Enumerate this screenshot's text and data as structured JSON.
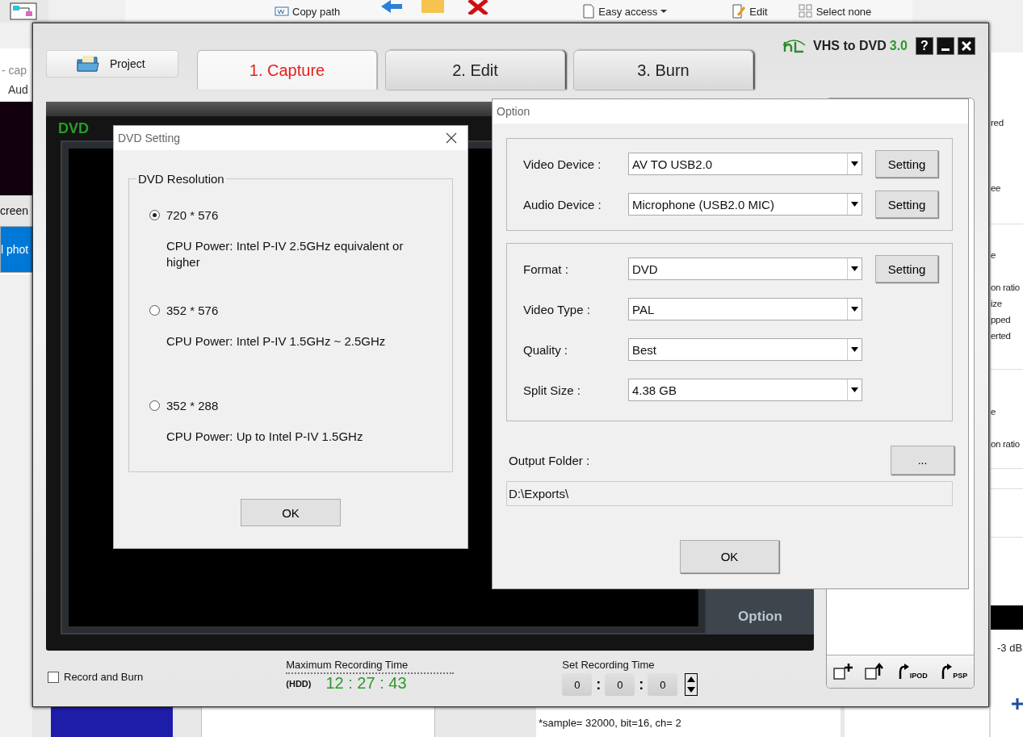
{
  "explorer_ribbon": {
    "items": [
      {
        "kind": "copy-path",
        "label": "Copy path"
      },
      {
        "kind": "easy-access",
        "label": "Easy access"
      },
      {
        "kind": "edit",
        "label": "Edit"
      },
      {
        "kind": "select-none",
        "label": "Select none"
      }
    ]
  },
  "left_window": {
    "title_fragment": "- cap",
    "tab_fragment": "Aud",
    "items": [
      {
        "label": "creen",
        "selected": false
      },
      {
        "label": "l phot",
        "selected": true
      }
    ]
  },
  "right_window": {
    "lines": [
      "red",
      "ee",
      "e",
      "on ratio",
      "ize",
      "pped",
      "erted",
      "e",
      "on ratio"
    ],
    "meter_label": "-3 dB"
  },
  "log_window": {
    "lines": [
      "*sample= 32000, bit=16, ch= 2"
    ]
  },
  "app": {
    "name": "VHS to DVD",
    "version": "3.0",
    "help_button": "?",
    "project_button": "Project",
    "tabs": [
      {
        "label": "1. Capture",
        "selected": true
      },
      {
        "label": "2. Edit",
        "selected": false
      },
      {
        "label": "3. Burn",
        "selected": false
      }
    ],
    "preview": {
      "format": "DVD",
      "option_button": "Option"
    },
    "record_and_burn": {
      "label": "Record and Burn",
      "checked": false
    },
    "max_recording_time": {
      "label": "Maximum Recording Time",
      "drive": "(HDD)",
      "value": "12 : 27 : 43"
    },
    "set_recording_time": {
      "label": "Set Recording Time",
      "fields": [
        "0",
        "0",
        "0"
      ],
      "separators": [
        ":",
        ":"
      ]
    },
    "list_tools": [
      {
        "kind": "add"
      },
      {
        "kind": "export"
      },
      {
        "kind": "convert",
        "label": "IPOD"
      },
      {
        "kind": "convert",
        "label": "PSP"
      }
    ]
  },
  "dvd_setting": {
    "title": "DVD Setting",
    "group": "DVD Resolution",
    "options": [
      {
        "label": "720 * 576",
        "description": "CPU Power: Intel P-IV 2.5GHz equivalent or higher",
        "selected": true
      },
      {
        "label": "352 * 576",
        "description": "CPU Power: Intel P-IV 1.5GHz ~ 2.5GHz",
        "selected": false
      },
      {
        "label": "352 * 288",
        "description": "CPU Power: Up to Intel P-IV 1.5GHz",
        "selected": false
      }
    ],
    "ok_button": "OK"
  },
  "option_dialog": {
    "title": "Option",
    "device_group": [
      {
        "label": "Video Device :",
        "value": "AV TO USB2.0",
        "button": "Setting"
      },
      {
        "label": "Audio Device :",
        "value": "Microphone (USB2.0 MIC)",
        "button": "Setting"
      }
    ],
    "format_group": [
      {
        "label": "Format :",
        "value": "DVD",
        "button": "Setting"
      },
      {
        "label": "Video Type :",
        "value": "PAL"
      },
      {
        "label": "Quality :",
        "value": "Best"
      },
      {
        "label": "Split Size :",
        "value": "4.38 GB"
      }
    ],
    "output_folder": {
      "label": "Output Folder :",
      "browse_button": "...",
      "path": "D:\\Exports\\"
    },
    "ok_button": "OK"
  }
}
